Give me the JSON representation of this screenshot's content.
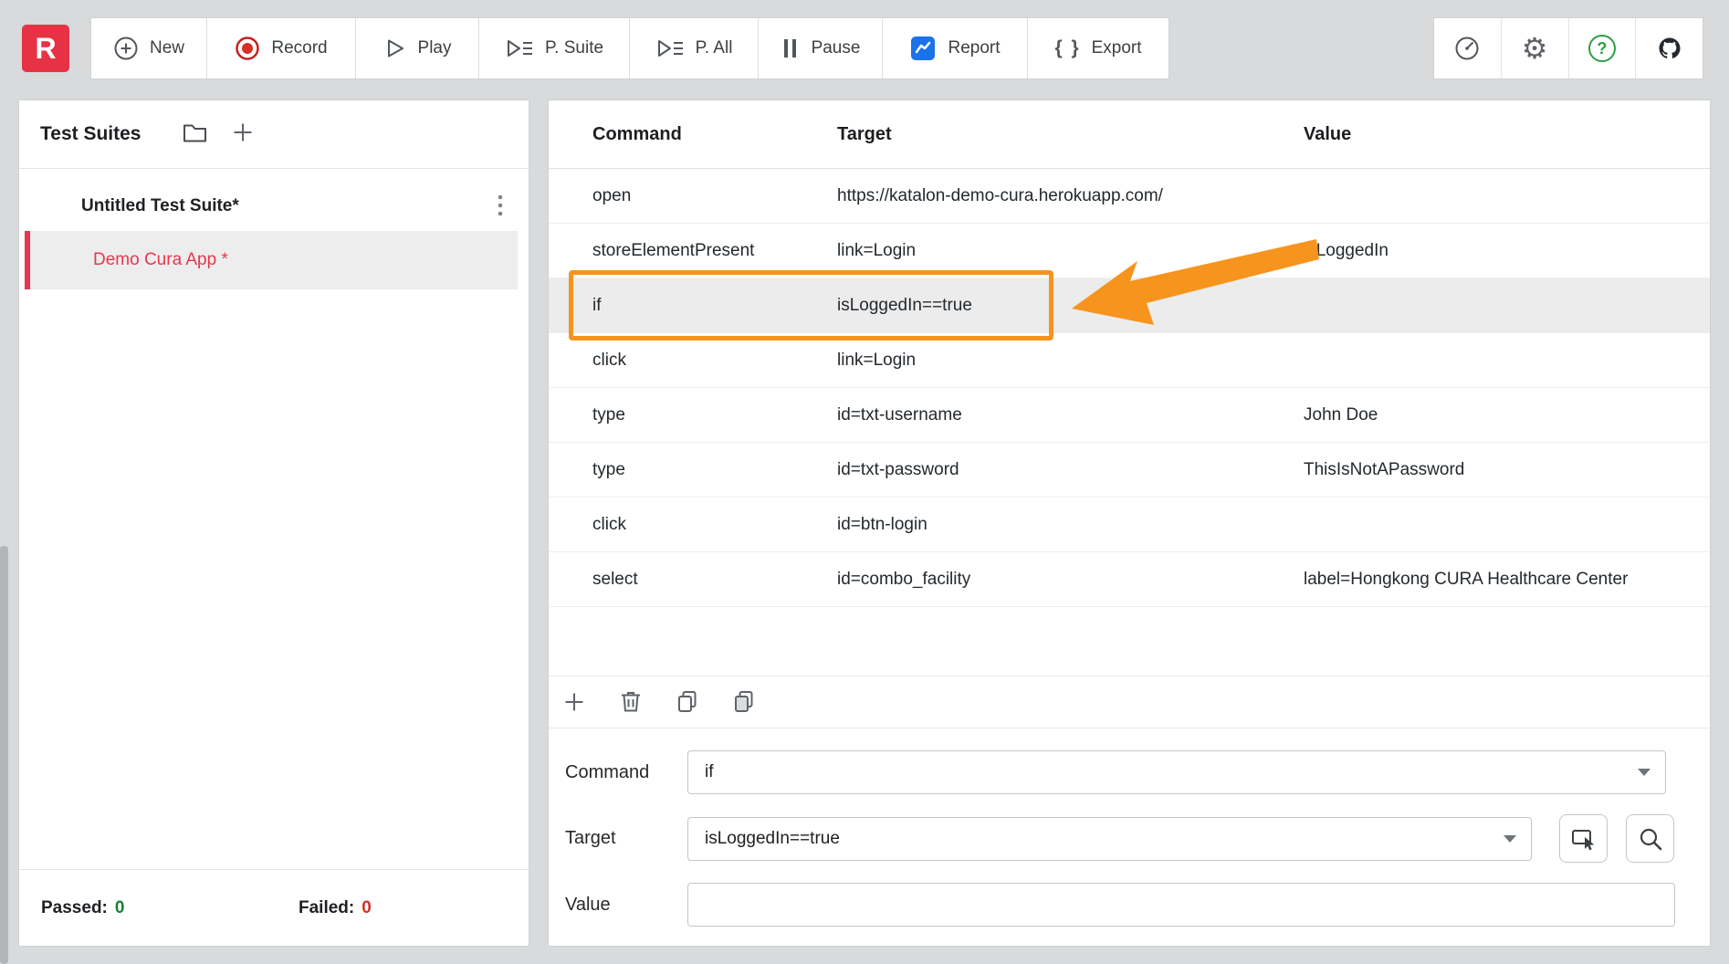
{
  "app": {
    "logo_letter": "R"
  },
  "toolbar": {
    "buttons": [
      {
        "label": "New"
      },
      {
        "label": "Record"
      },
      {
        "label": "Play"
      },
      {
        "label": "P. Suite"
      },
      {
        "label": "P. All"
      },
      {
        "label": "Pause"
      },
      {
        "label": "Report"
      },
      {
        "label": "Export"
      }
    ],
    "export_glyph": "{ }"
  },
  "icons": {
    "gear_glyph": "⚙",
    "help_glyph": "?"
  },
  "sidebar": {
    "title": "Test Suites",
    "suite_name": "Untitled Test Suite*",
    "case_name": "Demo Cura App *",
    "passed_label": "Passed:",
    "passed_count": "0",
    "failed_label": "Failed:",
    "failed_count": "0"
  },
  "table": {
    "headers": {
      "command": "Command",
      "target": "Target",
      "value": "Value"
    },
    "rows": [
      {
        "command": "open",
        "target": "https://katalon-demo-cura.herokuapp.com/",
        "value": ""
      },
      {
        "command": "storeElementPresent",
        "target": "link=Login",
        "value": "isLoggedIn"
      },
      {
        "command": "if",
        "target": "isLoggedIn==true",
        "value": ""
      },
      {
        "command": "click",
        "target": "link=Login",
        "value": ""
      },
      {
        "command": "type",
        "target": "id=txt-username",
        "value": "John Doe"
      },
      {
        "command": "type",
        "target": "id=txt-password",
        "value": "ThisIsNotAPassword"
      },
      {
        "command": "click",
        "target": "id=btn-login",
        "value": ""
      },
      {
        "command": "select",
        "target": "id=combo_facility",
        "value": "label=Hongkong CURA Healthcare Center"
      }
    ]
  },
  "editor": {
    "command_label": "Command",
    "command_value": "if",
    "target_label": "Target",
    "target_value": "isLoggedIn==true",
    "value_label": "Value"
  },
  "colors": {
    "brand_red": "#e8364d",
    "annotation_orange": "#f7941e",
    "passed_green": "#188038",
    "failed_red": "#d93025",
    "report_blue": "#1a73e8"
  }
}
